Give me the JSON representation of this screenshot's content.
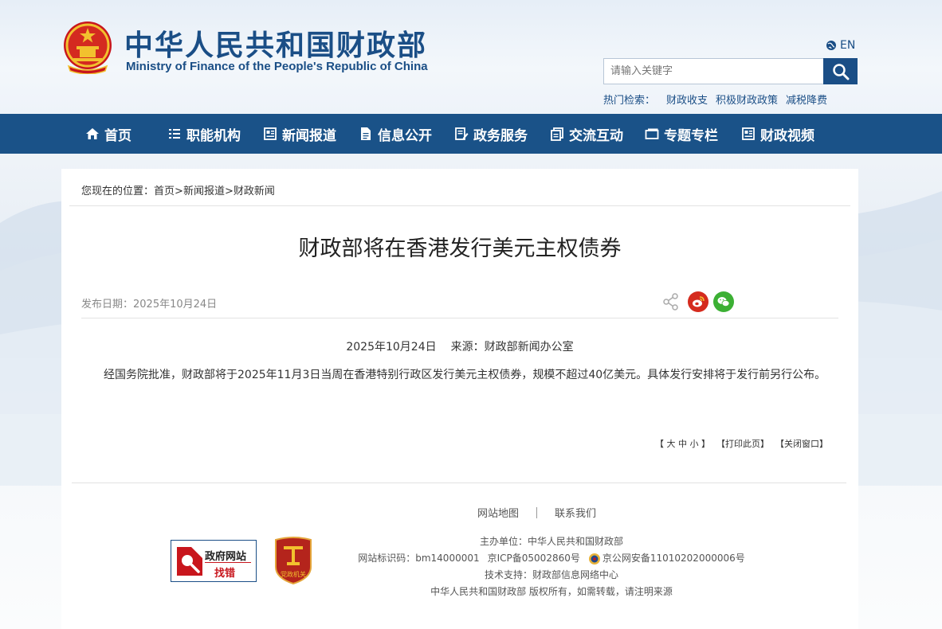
{
  "header": {
    "title_cn": "中华人民共和国财政部",
    "title_en": "Ministry of Finance of the People's Republic of China",
    "lang": "EN",
    "search_placeholder": "请输入关键字",
    "hot_label": "热门检索：",
    "hot_terms": [
      "财政收支",
      "积极财政政策",
      "减税降费"
    ]
  },
  "nav": {
    "items": [
      "首页",
      "职能机构",
      "新闻报道",
      "信息公开",
      "政务服务",
      "交流互动",
      "专题专栏",
      "财政视频"
    ]
  },
  "breadcrumb": {
    "prefix": "您现在的位置：",
    "items": [
      "首页",
      "新闻报道",
      "财政新闻"
    ],
    "sep": ">"
  },
  "article": {
    "title": "财政部将在香港发行美元主权债券",
    "pubdate": "发布日期：2025年10月24日",
    "date": "2025年10月24日",
    "source": "来源：财政部新闻办公室",
    "body": "经国务院批准，财政部将于2025年11月3日当周在香港特别行政区发行美元主权债券，规模不超过40亿美元。具体发行安排将于发行前另行公布。"
  },
  "tools": {
    "font_size": "【 大 中 小 】",
    "print": "【打印此页】",
    "close": "【关闭窗口】"
  },
  "footer": {
    "links": [
      "网站地图",
      "联系我们"
    ],
    "zfwz_line1": "政府网站",
    "zfwz_line2": "找错",
    "dzjg_text": "党政机关",
    "host": "主办单位：中华人民共和国财政部",
    "site_id": "网站标识码：bm14000001",
    "icp": "京ICP备05002860号",
    "police": "京公网安备11010202000006号",
    "tech": "技术支持：财政部信息网络中心",
    "copyright": "中华人民共和国财政部 版权所有，如需转载，请注明来源"
  },
  "colors": {
    "brand_blue": "#1a5288",
    "weibo_red": "#d52b1e",
    "wechat_green": "#3cb034"
  }
}
